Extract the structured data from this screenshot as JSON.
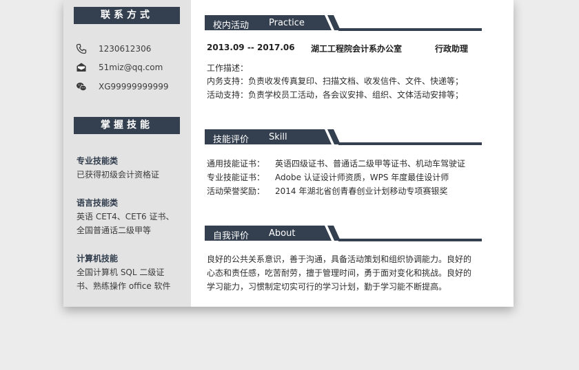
{
  "colors": {
    "accent": "#344050",
    "sidebar_bg": "#e3e3e3"
  },
  "sidebar": {
    "contact_title": "联系方式",
    "contacts": [
      {
        "icon": "phone-icon",
        "text": "1230612306"
      },
      {
        "icon": "mail-icon",
        "text": "51miz@qq.com"
      },
      {
        "icon": "wechat-icon",
        "text": "XG99999999999"
      }
    ],
    "skills_title": "掌握技能",
    "skills": [
      {
        "heading": "专业技能类",
        "lines": [
          "已获得初级会计资格证"
        ]
      },
      {
        "heading": "语言技能类",
        "lines": [
          "英语 CET4、CET6 证书、",
          "全国普通话二级甲等"
        ]
      },
      {
        "heading": "计算机技能",
        "lines": [
          "全国计算机 SQL 二级证",
          "书、熟练操作 office 软件"
        ]
      }
    ]
  },
  "practice": {
    "title_cn": "校内活动",
    "title_en": "Practice",
    "period": "2013.09 -- 2017.06",
    "org": "湖工工程院会计系办公室",
    "role": "行政助理",
    "desc_label": "工作描述：",
    "items": [
      "内务支持：负责收发传真复印、扫描文档、收发信件、文件、快递等；",
      "活动支持：负责学校员工活动，各会议安排、组织、文体活动安排等；"
    ]
  },
  "skill": {
    "title_cn": "技能评价",
    "title_en": "Skill",
    "rows": [
      {
        "k": "通用技能证书：",
        "v": "英语四级证书、普通话二级甲等证书、机动车驾驶证"
      },
      {
        "k": "专业技能证书：",
        "v": "Adobe 认证设计师资质，WPS 年度最佳设计师"
      },
      {
        "k": "活动荣誉奖励：",
        "v": "2014 年湖北省创青春创业计划移动专项赛银奖"
      }
    ]
  },
  "about": {
    "title_cn": "自我评价",
    "title_en": "About",
    "lines": [
      "良好的公共关系意识，善于沟通，具备活动策划和组织协调能力。良好的",
      "心态和责任感，吃苦耐劳，擅于管理时间，勇于面对变化和挑战。良好的",
      "学习能力，习惯制定切实可行的学习计划，勤于学习能不断提高。"
    ]
  }
}
